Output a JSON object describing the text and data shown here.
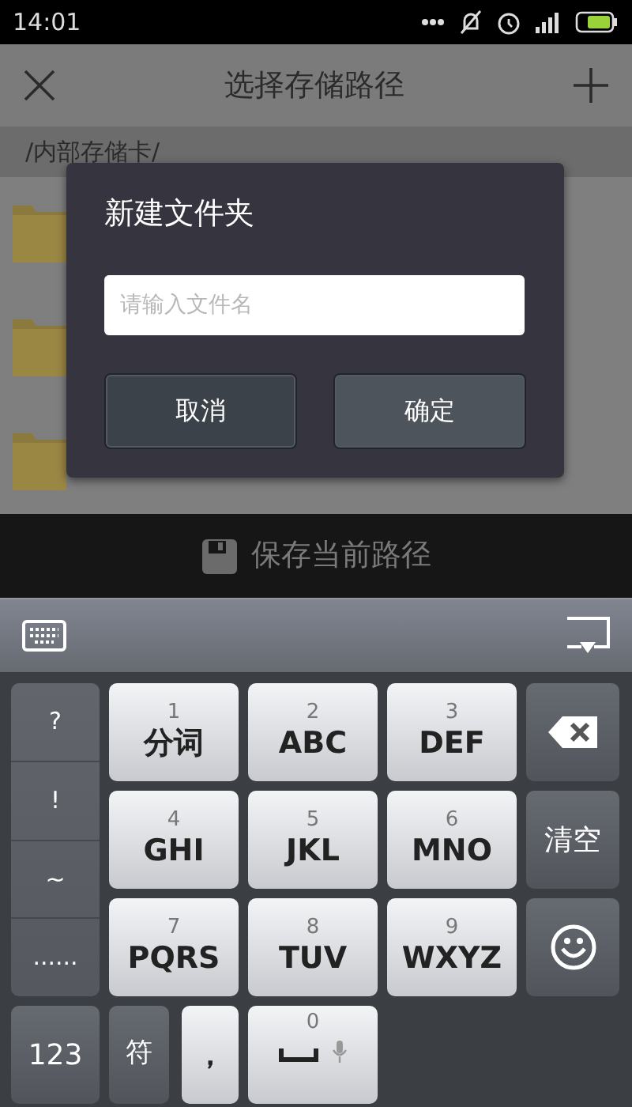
{
  "status_bar": {
    "time": "14:01"
  },
  "header": {
    "title": "选择存储路径"
  },
  "path": "/内部存储卡/",
  "dialog": {
    "title": "新建文件夹",
    "placeholder": "请输入文件名",
    "buttons": [
      {
        "label": "取消",
        "kind": "cancel"
      },
      {
        "label": "确定",
        "kind": "confirm"
      }
    ]
  },
  "save_bar": {
    "label": "保存当前路径"
  },
  "keyboard": {
    "symbols": [
      "?",
      "!",
      "~",
      "......"
    ],
    "keys": [
      {
        "digit": "1",
        "letters": "分词"
      },
      {
        "digit": "2",
        "letters": "ABC"
      },
      {
        "digit": "3",
        "letters": "DEF"
      },
      {
        "digit": "4",
        "letters": "GHI"
      },
      {
        "digit": "5",
        "letters": "JKL"
      },
      {
        "digit": "6",
        "letters": "MNO"
      },
      {
        "digit": "7",
        "letters": "PQRS"
      },
      {
        "digit": "8",
        "letters": "TUV"
      },
      {
        "digit": "9",
        "letters": "WXYZ"
      }
    ],
    "clear": "清空",
    "numbers": "123",
    "symbol_key": "符",
    "comma": "，",
    "space_digit": "0"
  }
}
